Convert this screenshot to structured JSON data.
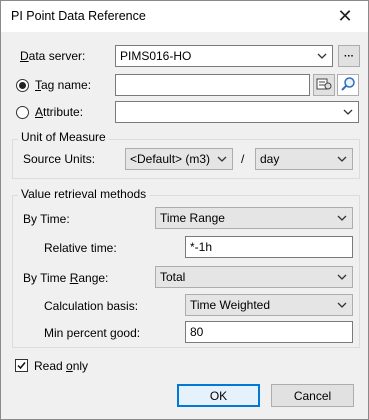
{
  "window": {
    "title": "PI Point Data Reference",
    "close": "✕"
  },
  "fields": {
    "data_server": {
      "label_pre": "",
      "label_u": "D",
      "label_post": "ata server:",
      "value": "PIMS016-HO",
      "browse": "···"
    },
    "tag_name": {
      "label_u": "T",
      "label_post": "ag name:",
      "value": ""
    },
    "attribute": {
      "label_u": "A",
      "label_post": "ttribute:",
      "value": ""
    }
  },
  "unit_of_measure": {
    "title": "Unit of Measure",
    "source_units_label": "Source Units:",
    "source_unit": "<Default> (m3)",
    "separator": "/",
    "per_unit": "day"
  },
  "value_retrieval": {
    "title": "Value retrieval methods",
    "by_time_label": "By Time:",
    "by_time": "Time Range",
    "relative_time_label": "Relative time:",
    "relative_time": "*-1h",
    "by_time_range_label_pre": "By Time ",
    "by_time_range_label_u": "R",
    "by_time_range_label_post": "ange:",
    "by_time_range": "Total",
    "calc_basis_label": "Calculation basis:",
    "calc_basis": "Time Weighted",
    "min_percent_label_pre": "Min percent ",
    "min_percent_label_u": "g",
    "min_percent_label_post": "ood:",
    "min_percent": "80"
  },
  "read_only": {
    "label_pre": "Read ",
    "label_u": "o",
    "label_post": "nly",
    "checked": true
  },
  "buttons": {
    "ok": "OK",
    "cancel": "Cancel"
  }
}
